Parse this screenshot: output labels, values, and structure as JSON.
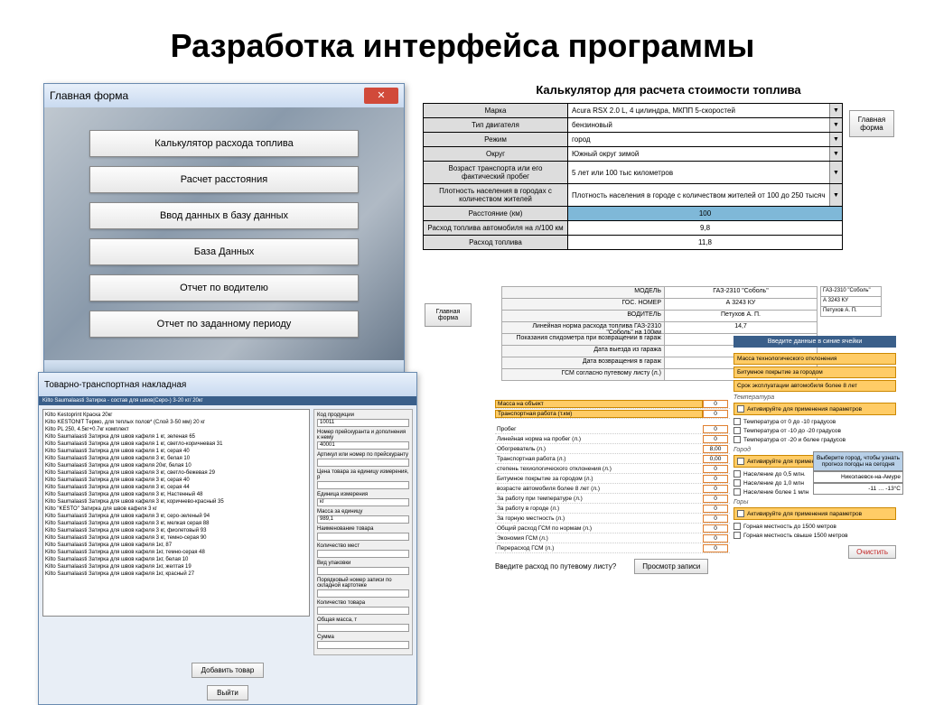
{
  "slide_title": "Разработка интерфейса программы",
  "main_window": {
    "title": "Главная форма",
    "buttons": [
      "Калькулятор расхода топлива",
      "Расчет расстояния",
      "Ввод данных в базу данных",
      "База Данных",
      "Отчет по водителю",
      "Отчет по заданному периоду"
    ]
  },
  "calculator": {
    "title": "Калькулятор для расчета стоимости топлива",
    "main_form_btn": "Главная форма",
    "rows": [
      {
        "label": "Марка",
        "value": "Acura RSX 2.0 L, 4 цилиндра, МКПП 5-скоростей",
        "dd": true
      },
      {
        "label": "Тип двигателя",
        "value": "бензиновый",
        "dd": true
      },
      {
        "label": "Режим",
        "value": "город",
        "dd": true
      },
      {
        "label": "Округ",
        "value": "Южный округ зимой",
        "dd": true
      },
      {
        "label": "Возраст транспорта или его фактический пробег",
        "value": "5 лет или 100 тыс километров",
        "dd": true
      },
      {
        "label": "Плотность населения в городах с количеством жителей",
        "value": "Плотность населения в городе с количеством жителей от 100 до 250 тысяч",
        "dd": true
      },
      {
        "label": "Расстояние (км)",
        "value": "100",
        "highlight": true
      },
      {
        "label": "Расход топлива автомобиля на л/100 км",
        "value": "9,8"
      },
      {
        "label": "Расход топлива",
        "value": "11,8"
      }
    ]
  },
  "vehicle": {
    "rows": [
      {
        "label": "МОДЕЛЬ",
        "value": "ГАЗ-2310 \"Соболь\""
      },
      {
        "label": "ГОС. НОМЕР",
        "value": "А 3243 КУ"
      },
      {
        "label": "ВОДИТЕЛЬ",
        "value": "Петухов А. П."
      },
      {
        "label": "Линейная норма расхода топлива ГАЗ-2310 \"Соболь\" на 100км",
        "value": "14,7"
      }
    ],
    "mini": [
      "ГАЗ-2310 \"Соболь\"",
      "А 3243 КУ",
      "Петухов А. П."
    ],
    "dates": [
      {
        "label": "Показания спидометра при возвращении в гараж",
        "value": ""
      },
      {
        "label": "Дата выезда из гаража",
        "value": ""
      },
      {
        "label": "Дата возвращения в гараж",
        "value": ""
      },
      {
        "label": "ГСМ согласно путевому листу (л.)",
        "value": ""
      }
    ]
  },
  "rp_instruction": "Введите данные в синие ячейки",
  "invoice": {
    "title": "Товарно-транспортная накладная",
    "tab": "Kilto Saumalaasti Затирка - состав для швов(Серо-) 3-20 кг/ 20кг",
    "lines": [
      "Kilto Kestoprint Краска 20кг",
      "Kilto KESTONIT Tермо, для теплых полов* (Слой 3-50 мм) 20 кг",
      "Kilto PL 250, 4.5кг+0.7кг комплект",
      "Kilto Saumalaasti Затирка для швов кафеля 1 кг, зеленая 65",
      "Kilto Saumalaasti Затирка для швов кафеля 1 кг, светло-коричневая 31",
      "Kilto Saumalaasti Затирка для швов кафеля 1 кг, серая 40",
      "Kilto Saumalaasti Затирка для швов кафеля 3 кг, белая 10",
      "Kilto Saumalaasti Затирка для швов кафеля 20кг, белая 10",
      "Kilto Saumalaasti Затирка для швов кафеля 3 кг, светло-бежевая 29",
      "Kilto Saumalaasti Затирка для швов кафеля 3 кг, серая 40",
      "Kilto Saumalaasti Затирка для швов кафеля 3 кг, серая 44",
      "Kilto Saumalaasti Затирка для швов кафеля 3 кг, Настенный 48",
      "Kilto Saumalaasti Затирка для швов кафеля 3 кг, коричнево-красный 35",
      "Kilto \"KESTO\" Затирка для швов кафеля 3 кг",
      "Kilto Saumalaasti Затирка для швов кафеля 3 кг, серо-зеленый 94",
      "Kilto Saumalaasti Затирка для швов кафеля 3 кг, мелкая серая 88",
      "Kilto Saumalaasti Затирка для швов кафеля 3 кг, фиолетовый 93",
      "Kilto Saumalaasti Затирка для швов кафеля 3 кг, темно-серая 90",
      "Kilto Saumalaasti Затирка для швов кафеля 1кг, 87",
      "Kilto Saumalaasti Затирка для швов кафеля 1кг, темно-серая 48",
      "Kilto Saumalaasti Затирка для швов кафеля 1кг, белая 10",
      "Kilto Saumalaasti Затирка для швов кафеля 1кг, желтая 19",
      "Kilto Saumalaasti Затирка для швов кафеля 1кг, красный 27"
    ],
    "fields": [
      {
        "label": "Код продукции",
        "value": "10011"
      },
      {
        "label": "Номер прейскуранта и дополнения к нему",
        "value": "40001"
      },
      {
        "label": "Артикул или номер по прейскуранту",
        "value": ""
      },
      {
        "label": "Цена товара за единицу измерения, р",
        "value": ""
      },
      {
        "label": "Единица измерения",
        "value": "кг"
      },
      {
        "label": "Масса за единицу",
        "value": "989,1"
      },
      {
        "label": "Наименование товара",
        "value": ""
      },
      {
        "label": "Количество мест",
        "value": ""
      },
      {
        "label": "Вид упаковки",
        "value": ""
      },
      {
        "label": "Порядковый номер записи по складной картотеке",
        "value": ""
      },
      {
        "label": "Количество товара",
        "value": ""
      },
      {
        "label": "Общая масса, т",
        "value": ""
      },
      {
        "label": "Сумма",
        "value": ""
      }
    ],
    "add_btn": "Добавить товар",
    "exit_btn": "Выйти"
  },
  "worksheet": {
    "orange_rows": [
      {
        "label": "Масса на объект",
        "value": "0"
      },
      {
        "label": "Транспортная работа (т.км)",
        "value": "0"
      }
    ],
    "rows": [
      {
        "label": "Пробег",
        "value": "0"
      },
      {
        "label": "Линейная норма на пробег (л.)",
        "value": "0"
      },
      {
        "label": "Обогреватель (л.)",
        "value": "8,00"
      },
      {
        "label": "Транспортная работа (л.)",
        "value": "0,00"
      },
      {
        "label": "степень техиологического отклонения (л.)",
        "value": "0"
      },
      {
        "label": "Битумное покрытие за городом (л.)",
        "value": "0"
      },
      {
        "label": "возрасте автомобиля более 8 лет (л.)",
        "value": "0"
      },
      {
        "label": "За работу при температуре (л.)",
        "value": "0"
      },
      {
        "label": "За работу в городе (л.)",
        "value": "0"
      },
      {
        "label": "За горную местность (л.)",
        "value": "0"
      },
      {
        "label": "Общий расход ГСМ по нормам (л.)",
        "value": "0"
      },
      {
        "label": "Экономия ГСМ (л.)",
        "value": "0"
      },
      {
        "label": "Перерасход ГСМ (л.)",
        "value": "0"
      }
    ],
    "footer_prompt": "Введите расход по путевому листу?",
    "footer_btn": "Просмотр записи"
  },
  "right_panel": {
    "orange_items": [
      "Масса технологического отклонения",
      "Битумное покрытие за городом",
      "Срок эксплуатации автомобиля более 8 лет"
    ],
    "sections": [
      {
        "title": "Температура",
        "head": "Активируйте для применения параметров",
        "items": [
          "Температура от 0 до -10 градусов",
          "Температура от -10 до -20 градусов",
          "Температура от -20 и более градусов"
        ]
      },
      {
        "title": "Город",
        "head": "Активируйте для применения параметров",
        "items": [
          "Население до 0,5 млн.",
          "Население до 1,0 млн",
          "Население более 1 млн"
        ]
      },
      {
        "title": "Горы",
        "head": "Активируйте для применения параметров",
        "items": [
          "Горная местность до 1500 метров",
          "Горная местность свыше 1500 метров"
        ]
      }
    ],
    "city_prompt": "Выберите город, чтобы узнать прогноз погоды на сегодня",
    "city_name": "Николаевск-на-Амуре",
    "city_temp": "-11 … -13°C",
    "clear_btn": "Очистить"
  },
  "gf2_btn": "Главная форма"
}
